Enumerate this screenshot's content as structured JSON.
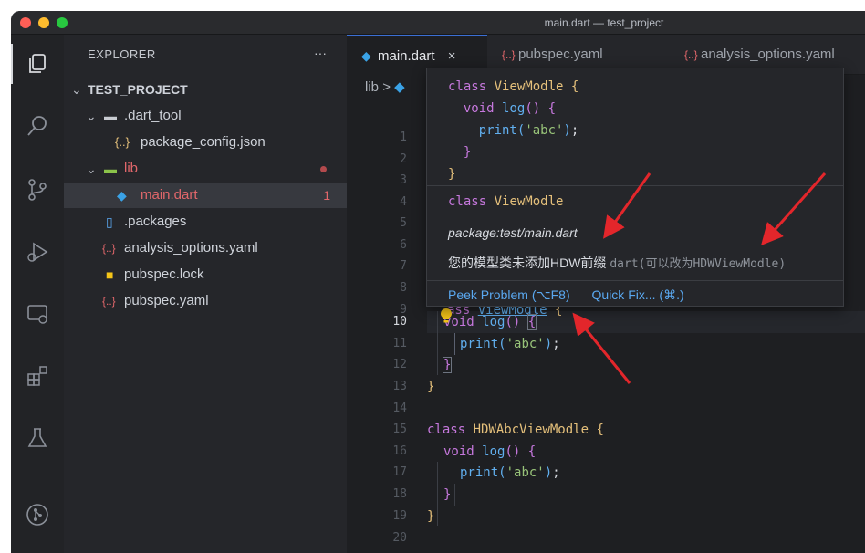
{
  "window": {
    "title": "main.dart — test_project"
  },
  "sidebar": {
    "header": "EXPLORER",
    "more": "···",
    "project": "TEST_PROJECT",
    "items": [
      {
        "label": ".dart_tool",
        "icon": "folder-icon"
      },
      {
        "label": "package_config.json",
        "icon": "json-icon"
      },
      {
        "label": "lib",
        "icon": "folder-lib-icon"
      },
      {
        "label": "main.dart",
        "icon": "dart-icon",
        "badge": "1"
      },
      {
        "label": ".packages",
        "icon": "file-icon"
      },
      {
        "label": "analysis_options.yaml",
        "icon": "yaml-icon"
      },
      {
        "label": "pubspec.lock",
        "icon": "lock-icon"
      },
      {
        "label": "pubspec.yaml",
        "icon": "yaml-icon"
      }
    ]
  },
  "tabs": [
    {
      "label": "main.dart",
      "close": "×"
    },
    {
      "label": "pubspec.yaml"
    },
    {
      "label": "analysis_options.yaml"
    }
  ],
  "breadcrumb": {
    "folder": "lib",
    "sep": ">"
  },
  "hover": {
    "code": [
      "class ViewModle {",
      "  void log() {",
      "    print('abc');",
      "  }",
      "}"
    ],
    "signature": "class ViewModle",
    "package": "package:test/main.dart",
    "message": "您的模型类未添加HDW前缀",
    "source": "dart(可以改为HDWViewModle)",
    "action_peek": "Peek Problem (⌥F8)",
    "action_fix": "Quick Fix... (⌘.)"
  },
  "editor": {
    "line_numbers": [
      "1",
      "2",
      "3",
      "4",
      "5",
      "6",
      "7",
      "8",
      "9",
      "10",
      "11",
      "12",
      "13",
      "14",
      "15",
      "16",
      "17",
      "18",
      "19",
      "20"
    ],
    "current_line": "10",
    "class2": "HDWAbcViewModle",
    "class1": "ViewModle",
    "method": "log",
    "string": "'abc'"
  },
  "colors": {
    "arrow": "#e3262b",
    "accent": "#3b6fd4",
    "error": "#e2676b"
  }
}
